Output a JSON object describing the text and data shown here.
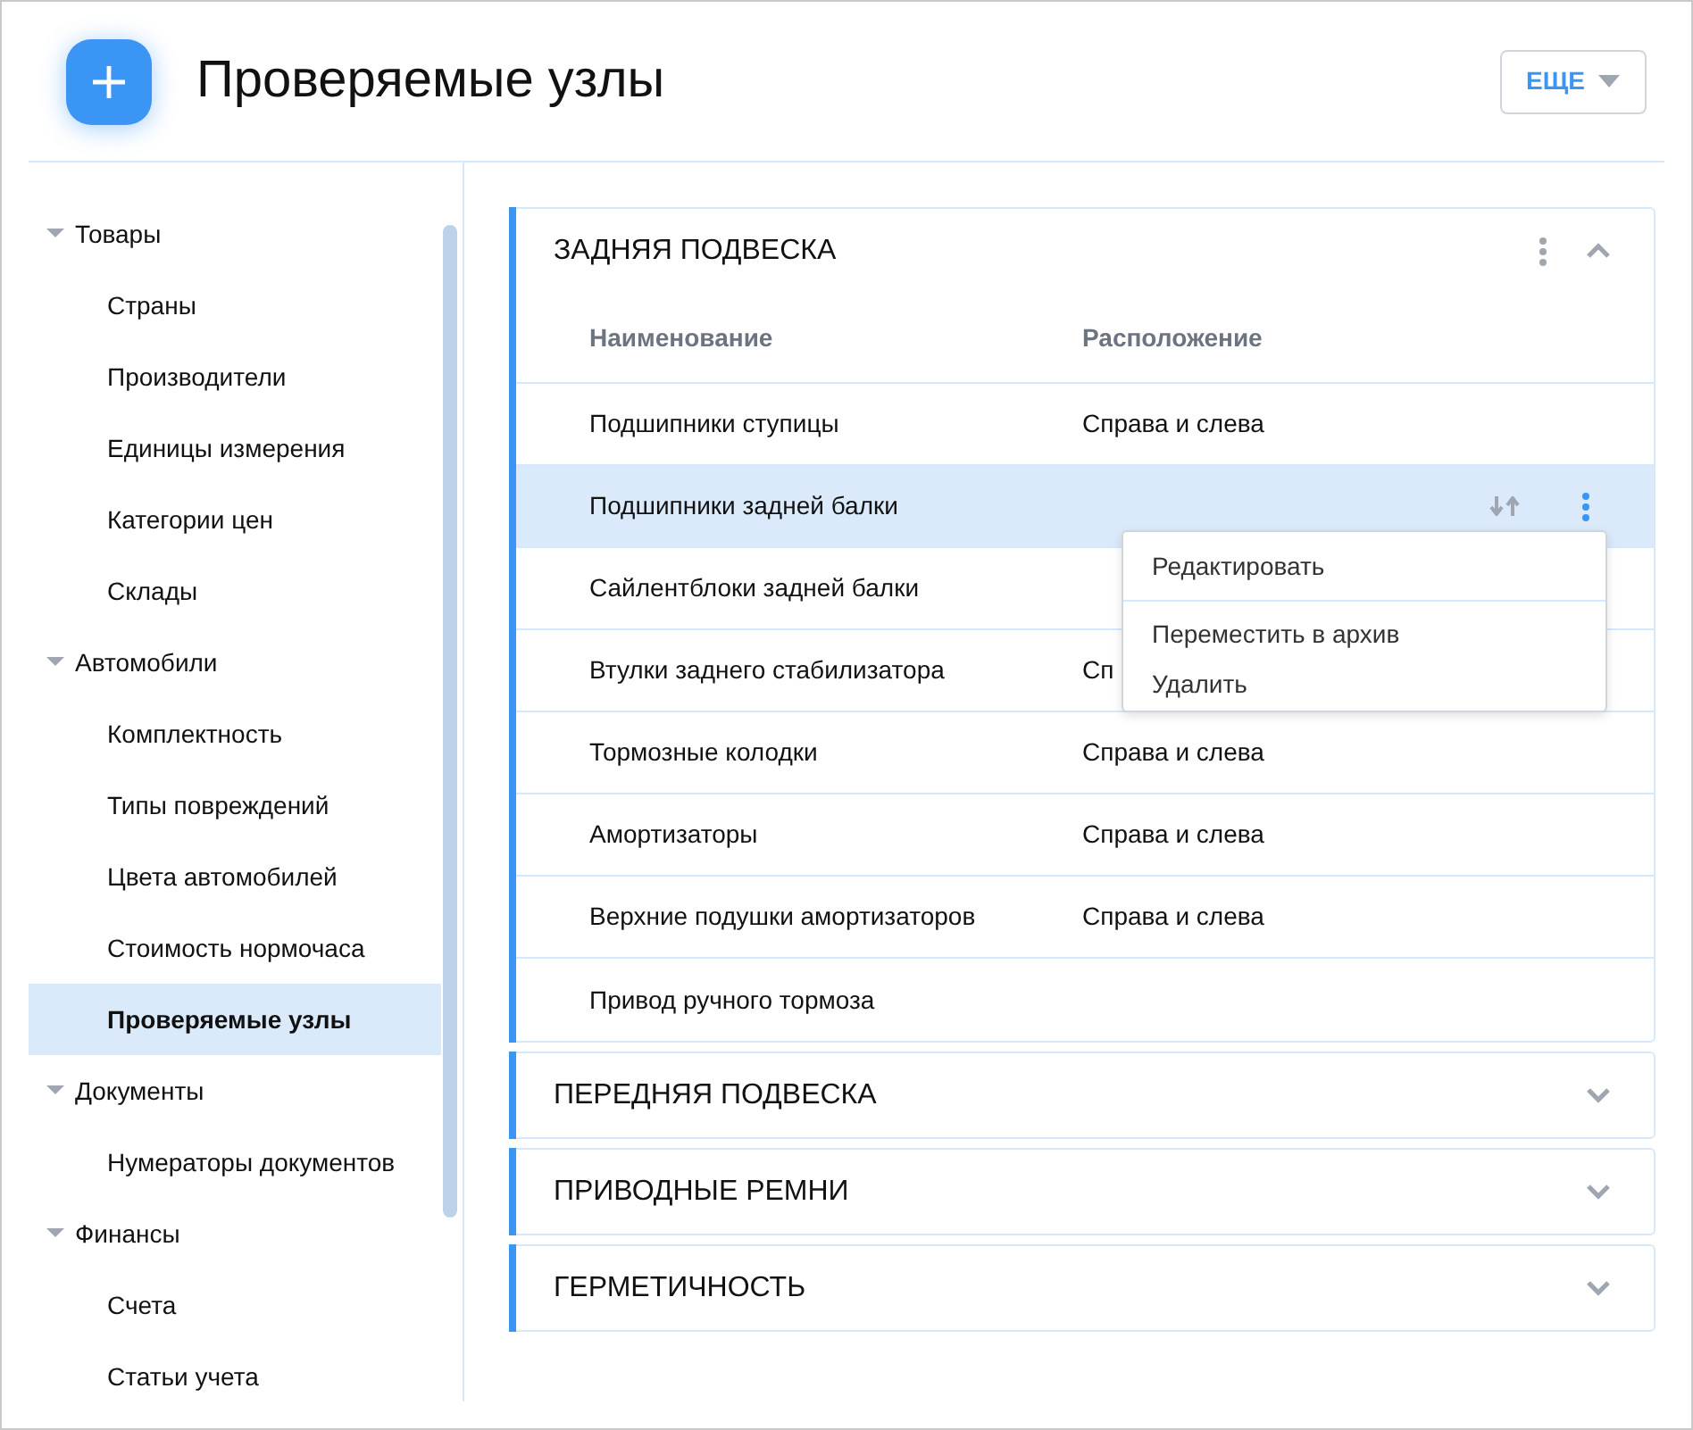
{
  "header": {
    "title": "Проверяемые узлы",
    "more_button": "ЕЩЕ"
  },
  "sidebar": {
    "items": [
      {
        "label": "Товары",
        "expanded": true,
        "selected": false,
        "children": [
          {
            "label": "Страны",
            "selected": false
          },
          {
            "label": "Производители",
            "selected": false
          },
          {
            "label": "Единицы измерения",
            "selected": false
          },
          {
            "label": "Категории цен",
            "selected": false
          },
          {
            "label": "Склады",
            "selected": false
          }
        ]
      },
      {
        "label": "Автомобили",
        "expanded": true,
        "selected": false,
        "children": [
          {
            "label": "Комплектность",
            "selected": false
          },
          {
            "label": "Типы повреждений",
            "selected": false
          },
          {
            "label": "Цвета автомобилей",
            "selected": false
          },
          {
            "label": "Стоимость нормочаса",
            "selected": false
          },
          {
            "label": "Проверяемые узлы",
            "selected": true
          }
        ]
      },
      {
        "label": "Документы",
        "expanded": true,
        "selected": false,
        "children": [
          {
            "label": "Нумераторы документов",
            "selected": false
          }
        ]
      },
      {
        "label": "Финансы",
        "expanded": true,
        "selected": false,
        "children": [
          {
            "label": "Счета",
            "selected": false
          },
          {
            "label": "Статьи учета",
            "selected": false
          }
        ]
      }
    ]
  },
  "sections": [
    {
      "title": "ЗАДНЯЯ ПОДВЕСКА",
      "expanded": true,
      "columns": [
        "Наименование",
        "Расположение"
      ],
      "rows": [
        {
          "name": "Подшипники ступицы",
          "location": "Справа и слева",
          "selected": false
        },
        {
          "name": "Подшипники задней балки",
          "selected": true
        },
        {
          "name": "Сайлентблоки задней балки",
          "selected": false
        },
        {
          "name": "Втулки заднего стабилизатора",
          "location": "Сп",
          "selected": false
        },
        {
          "name": "Тормозные колодки",
          "location": "Справа и слева",
          "selected": false
        },
        {
          "name": "Амортизаторы",
          "location": "Справа и слева",
          "selected": false
        },
        {
          "name": "Верхние подушки амортизаторов",
          "location": "Справа и слева",
          "selected": false
        },
        {
          "name": "Привод ручного тормоза",
          "selected": false
        }
      ]
    },
    {
      "title": "ПЕРЕДНЯЯ ПОДВЕСКА",
      "expanded": false
    },
    {
      "title": "ПРИВОДНЫЕ РЕМНИ",
      "expanded": false
    },
    {
      "title": "ГЕРМЕТИЧНОСТЬ",
      "expanded": false
    }
  ],
  "context_menu": {
    "groups": [
      [
        "Редактировать"
      ],
      [
        "Переместить в архив",
        "Удалить"
      ]
    ]
  }
}
